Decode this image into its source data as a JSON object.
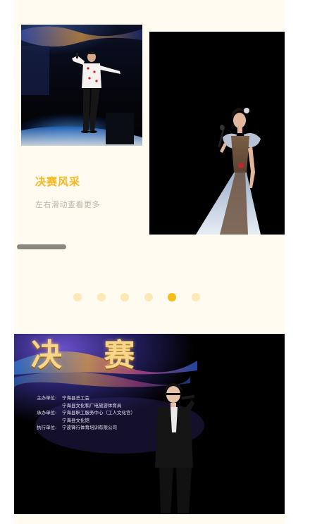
{
  "gallery": {
    "caption_title": "决赛风采",
    "caption_hint": "左右滑动查看更多",
    "photos": [
      {
        "name": "male-singer-photo"
      },
      {
        "name": "female-singer-photo"
      }
    ],
    "scroll_position": 0.0
  },
  "pagination": {
    "count": 6,
    "active_index": 4,
    "inactive_color": "#fbe9b7",
    "active_color": "#f5bd17"
  },
  "poster": {
    "heading": "决 赛",
    "info_rows": [
      {
        "key": "主办单位:",
        "value": "宁海县总工会"
      },
      {
        "key": "",
        "value": "宁海县文化和广电旅游体育局"
      },
      {
        "key": "承办单位:",
        "value": "宁海县职工服务中心（工人文化宫）"
      },
      {
        "key": "",
        "value": "宁海县文化馆"
      },
      {
        "key": "执行单位:",
        "value": "宁波锋行体育培训有限公司"
      }
    ]
  },
  "colors": {
    "card_background": "#fffbf0",
    "accent": "#f5b81f",
    "hint_text": "#b9b4a8"
  }
}
